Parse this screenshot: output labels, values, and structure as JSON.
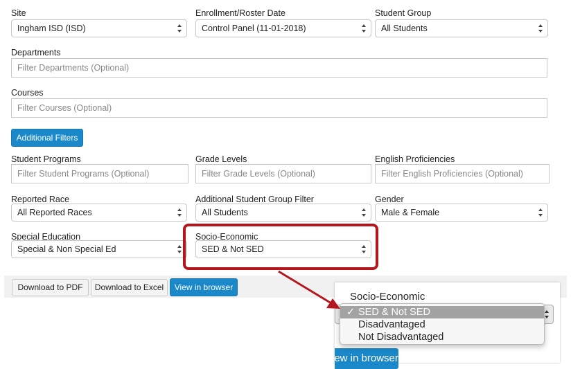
{
  "filters": {
    "site": {
      "label": "Site",
      "value": "Ingham ISD (ISD)"
    },
    "enrollment": {
      "label": "Enrollment/Roster Date",
      "value": "Control Panel (11-01-2018)"
    },
    "student_group": {
      "label": "Student Group",
      "value": "All Students"
    },
    "departments": {
      "label": "Departments",
      "placeholder": "Filter Departments (Optional)"
    },
    "courses": {
      "label": "Courses",
      "placeholder": "Filter Courses (Optional)"
    },
    "additional_filters_button": "Additional Filters",
    "student_programs": {
      "label": "Student Programs",
      "placeholder": "Filter Student Programs (Optional)"
    },
    "grade_levels": {
      "label": "Grade Levels",
      "placeholder": "Filter Grade Levels (Optional)"
    },
    "english_proficiencies": {
      "label": "English Proficiencies",
      "placeholder": "Filter English Proficiencies (Optional)"
    },
    "reported_race": {
      "label": "Reported Race",
      "value": "All Reported Races"
    },
    "additional_group": {
      "label": "Additional Student Group Filter",
      "value": "All Students"
    },
    "gender": {
      "label": "Gender",
      "value": "Male & Female"
    },
    "special_education": {
      "label": "Special Education",
      "value": "Special & Non Special Ed"
    },
    "socio_economic": {
      "label": "Socio-Economic",
      "value": "SED & Not SED"
    }
  },
  "actions": {
    "download_pdf": "Download to PDF",
    "download_excel": "Download to Excel",
    "view_browser": "View in browser"
  },
  "callout": {
    "label": "Socio-Economic",
    "options": [
      {
        "label": "SED & Not SED",
        "selected": true
      },
      {
        "label": "Disadvantaged",
        "selected": false
      },
      {
        "label": "Not Disadvantaged",
        "selected": false
      }
    ],
    "check_mark": "✓",
    "partial_button": "iew in browser"
  },
  "colors": {
    "accent": "#1b88c9",
    "highlight": "#b3171d",
    "selected_option": "#a3a3a3"
  }
}
